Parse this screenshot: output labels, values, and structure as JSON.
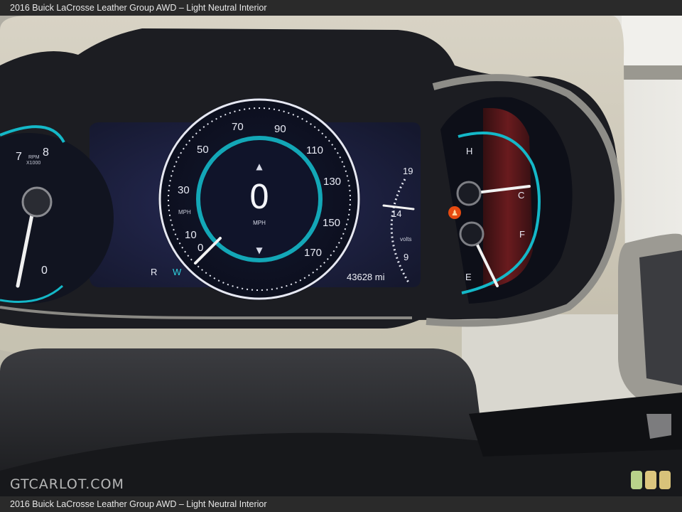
{
  "caption": "2016 Buick LaCrosse Leather Group AWD – Light Neutral Interior",
  "watermark": "GTCARLOT.COM",
  "swatch_colors": [
    "#b8d28a",
    "#dcc67e",
    "#d8c27a"
  ],
  "tachometer": {
    "ticks": [
      "7",
      "8"
    ],
    "unit": "RPM",
    "multiplier": "X1000",
    "zero_label": "0"
  },
  "speedometer": {
    "ticks": [
      "0",
      "10",
      "30",
      "50",
      "70",
      "90",
      "110",
      "130",
      "150",
      "170"
    ],
    "unit_ring": "MPH",
    "speed": "0",
    "speed_unit": "MPH"
  },
  "voltmeter": {
    "ticks": [
      "19",
      "14",
      "9"
    ],
    "unit": "volts"
  },
  "gear": {
    "r": "R",
    "w": "W"
  },
  "odometer": "43628 mi",
  "temp_gauge": {
    "hot": "H",
    "cold": "C"
  },
  "fuel_gauge": {
    "full": "F",
    "empty": "E"
  }
}
